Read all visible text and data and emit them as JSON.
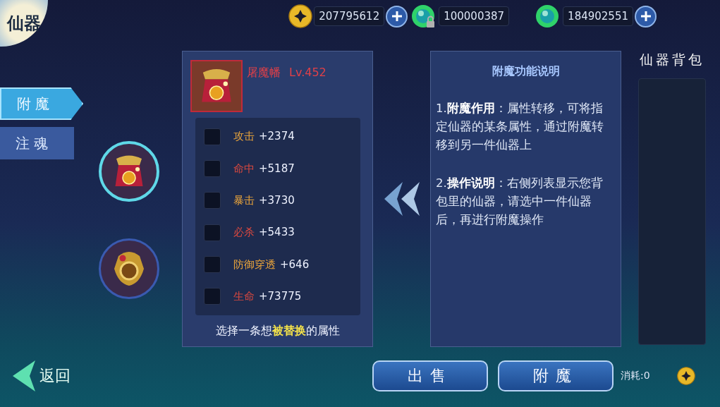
{
  "title": "仙器",
  "currencies": [
    {
      "kind": "coin",
      "value": "207795612",
      "addable": true
    },
    {
      "kind": "jade_locked",
      "value": "100000387",
      "addable": false
    },
    {
      "kind": "jade",
      "value": "184902551",
      "addable": true
    }
  ],
  "tabs": [
    {
      "label": "附魔",
      "selected": true
    },
    {
      "label": "注魂",
      "selected": false
    }
  ],
  "slots": [
    {
      "selected": true
    },
    {
      "selected": false
    }
  ],
  "item": {
    "name": "屠魔幡",
    "level": "Lv.452",
    "attributes": [
      {
        "name": "攻击",
        "value": "+2374",
        "color": "#e9a43b",
        "checked": false
      },
      {
        "name": "命中",
        "value": "+5187",
        "color": "#d8483f",
        "checked": false
      },
      {
        "name": "暴击",
        "value": "+3730",
        "color": "#e9a43b",
        "checked": false
      },
      {
        "name": "必杀",
        "value": "+5433",
        "color": "#d8483f",
        "checked": false
      },
      {
        "name": "防御穿透",
        "value": "+646",
        "color": "#e9a43b",
        "checked": false
      },
      {
        "name": "生命",
        "value": "+73775",
        "color": "#d8483f",
        "checked": false
      }
    ],
    "hint": "选择一条想**被替换**的属性"
  },
  "description": {
    "title": "附魔功能说明",
    "paragraphs": [
      "1.**附魔作用**：属性转移，可将指定仙器的某条属性，通过附魔转移到另一件仙器上",
      "2.**操作说明**：右侧列表显示您背包里的仙器，请选中一件仙器后，再进行附魔操作"
    ]
  },
  "bag": {
    "title": "仙器背包"
  },
  "footer": {
    "back": "返回",
    "buttons": [
      "出售",
      "附魔"
    ],
    "cost": "消耗:0"
  }
}
